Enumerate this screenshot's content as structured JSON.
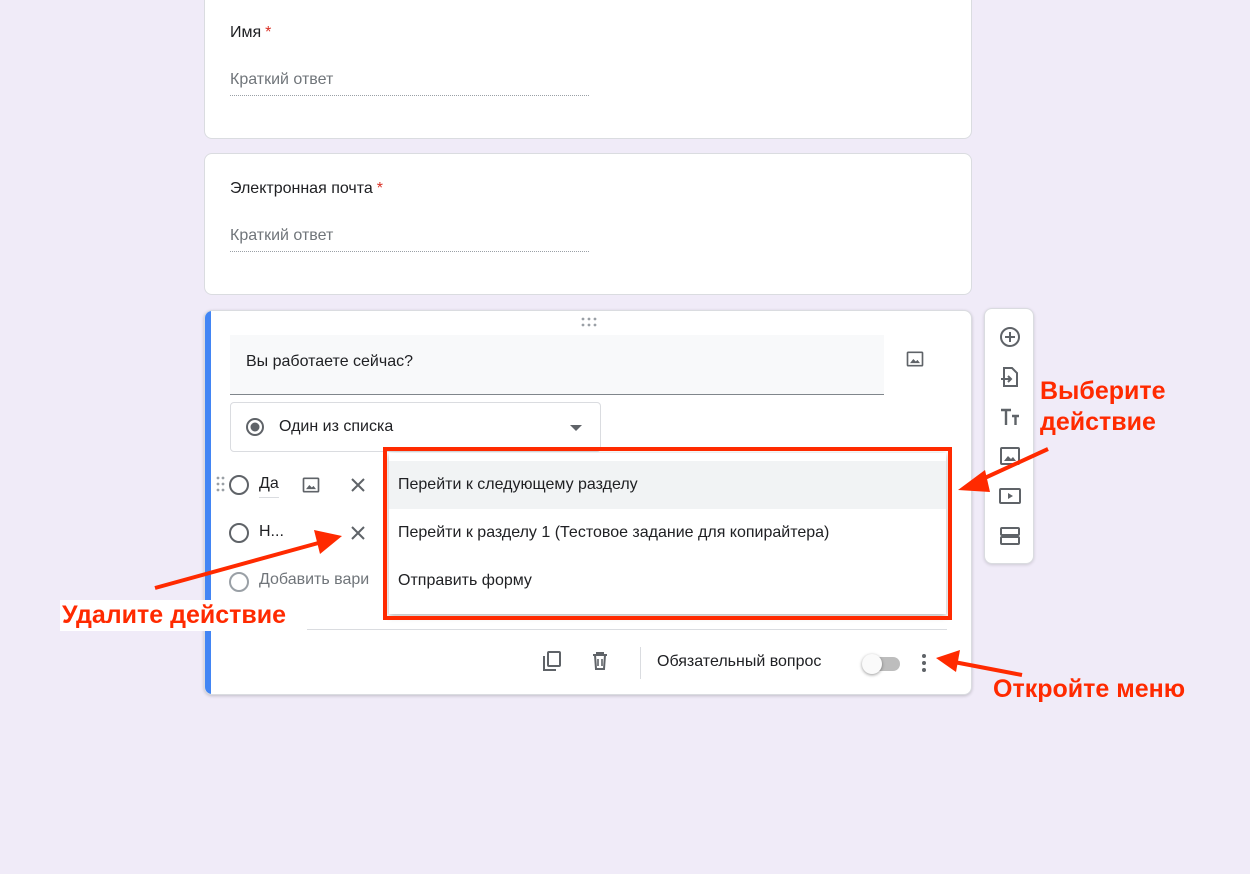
{
  "questions": {
    "name": {
      "title": "Имя",
      "required_mark": "*",
      "placeholder": "Краткий ответ"
    },
    "email": {
      "title": "Электронная почта",
      "required_mark": "*",
      "placeholder": "Краткий ответ"
    },
    "active": {
      "title": "Вы работаете сейчас?",
      "type_label": "Один из списка",
      "options": [
        {
          "label": "Да"
        },
        {
          "label": "Н..."
        }
      ],
      "add_option_label": "Добавить вари",
      "required_label": "Обязательный вопрос",
      "required_on": false
    }
  },
  "section_menu": {
    "items": [
      {
        "label": "Перейти к следующему разделу"
      },
      {
        "label": "Перейти к разделу 1 (Тестовое задание для копирайтера)"
      },
      {
        "label": "Отправить форму"
      }
    ]
  },
  "side_toolbar": {
    "icons": [
      "add-question-icon",
      "import-questions-icon",
      "add-title-icon",
      "add-image-icon",
      "add-video-icon",
      "add-section-icon"
    ]
  },
  "annotations": {
    "delete_action": "Удалите действие",
    "choose_action": "Выберите\nдействие",
    "open_menu": "Откройте меню"
  },
  "colors": {
    "background": "#f0ebf8",
    "accent": "#4285f4",
    "required": "#d93025",
    "annotation": "#ff2a00"
  }
}
